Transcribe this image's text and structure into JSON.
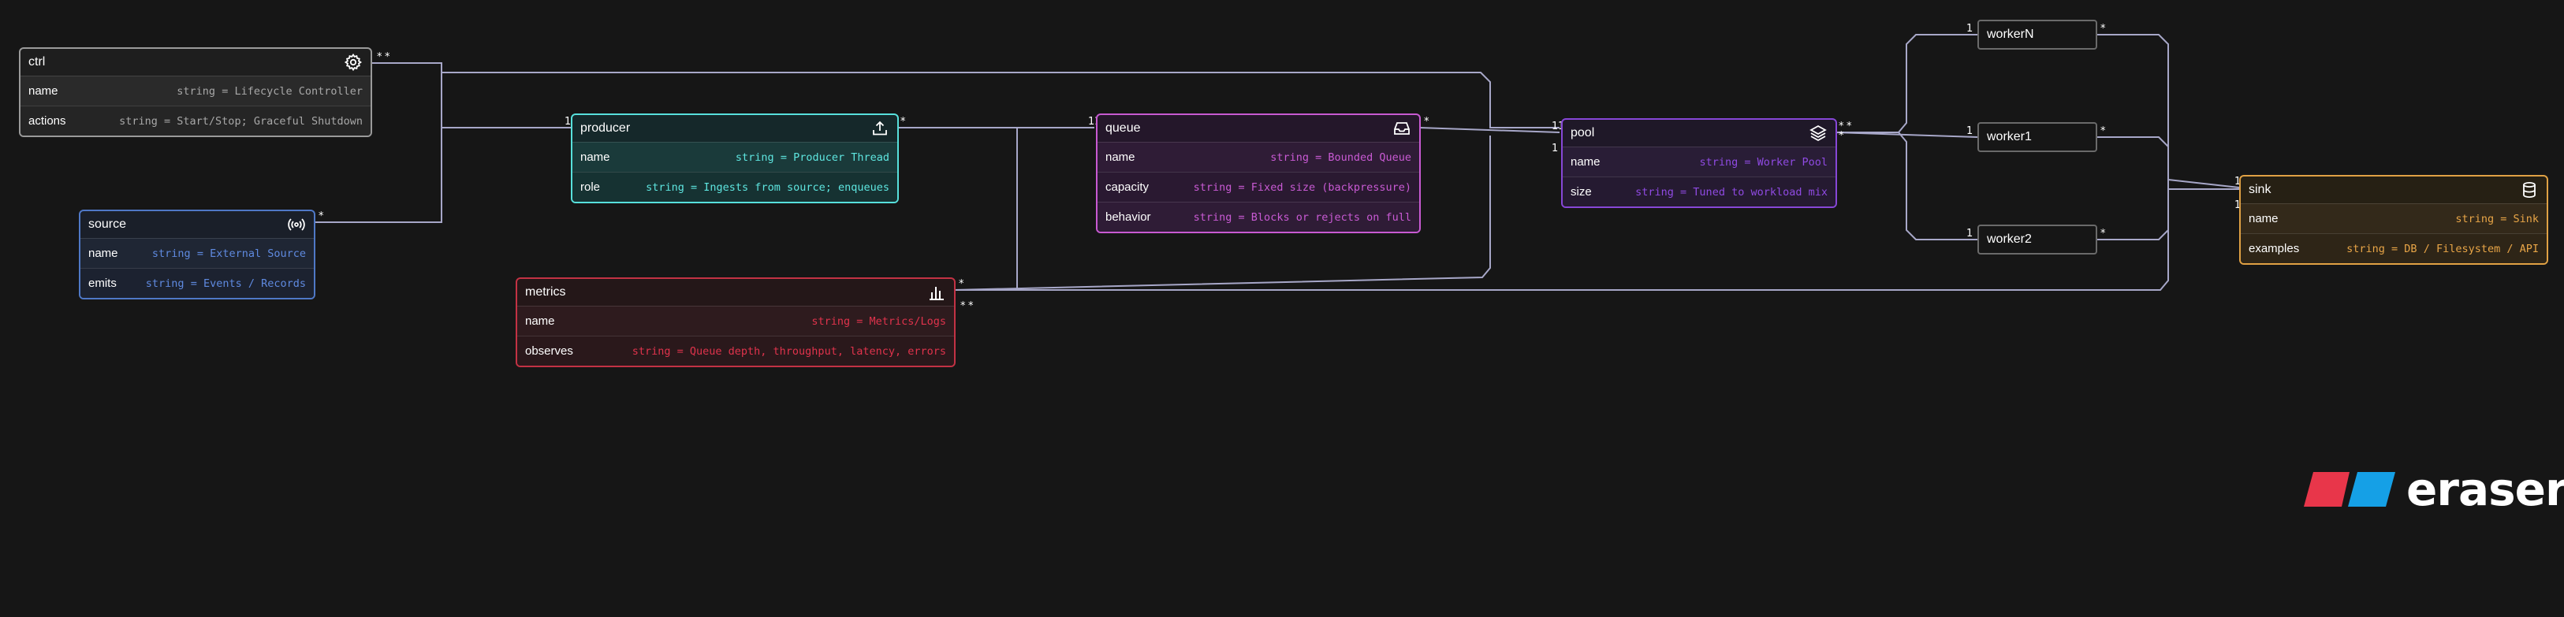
{
  "colors": {
    "ctrl": "#9a9a9a",
    "source": "#4f78c6",
    "producer": "#57e0dc",
    "metrics": "#c33244",
    "queue": "#c85ad2",
    "pool": "#8747d7",
    "sink": "#e0a144",
    "edge": "#a7a7c8",
    "logo_red": "#e8364a",
    "logo_blue": "#15a0e6"
  },
  "entities": {
    "ctrl": {
      "title": "ctrl",
      "icon": "gear-icon",
      "fields": [
        {
          "name": "name",
          "type": "string = Lifecycle Controller"
        },
        {
          "name": "actions",
          "type": "string = Start/Stop; Graceful Shutdown"
        }
      ]
    },
    "source": {
      "title": "source",
      "icon": "broadcast-icon",
      "fields": [
        {
          "name": "name",
          "type": "string = External Source"
        },
        {
          "name": "emits",
          "type": "string = Events / Records"
        }
      ]
    },
    "producer": {
      "title": "producer",
      "icon": "upload-icon",
      "fields": [
        {
          "name": "name",
          "type": "string = Producer Thread"
        },
        {
          "name": "role",
          "type": "string = Ingests from source; enqueues"
        }
      ]
    },
    "metrics": {
      "title": "metrics",
      "icon": "bar-chart-icon",
      "fields": [
        {
          "name": "name",
          "type": "string = Metrics/Logs"
        },
        {
          "name": "observes",
          "type": "string = Queue depth, throughput, latency, errors"
        }
      ]
    },
    "queue": {
      "title": "queue",
      "icon": "inbox-icon",
      "fields": [
        {
          "name": "name",
          "type": "string = Bounded Queue"
        },
        {
          "name": "capacity",
          "type": "string = Fixed size (backpressure)"
        },
        {
          "name": "behavior",
          "type": "string = Blocks or rejects on full"
        }
      ]
    },
    "pool": {
      "title": "pool",
      "icon": "layers-icon",
      "fields": [
        {
          "name": "name",
          "type": "string = Worker Pool"
        },
        {
          "name": "size",
          "type": "string = Tuned to workload mix"
        }
      ]
    },
    "sink": {
      "title": "sink",
      "icon": "database-icon",
      "fields": [
        {
          "name": "name",
          "type": "string = Sink"
        },
        {
          "name": "examples",
          "type": "string = DB / Filesystem / API"
        }
      ]
    }
  },
  "workers": {
    "workerN": "workerN",
    "worker1": "worker1",
    "worker2": "worker2"
  },
  "cardinality": {
    "one": "1",
    "many": "*"
  },
  "logo": {
    "text": "eraser"
  }
}
